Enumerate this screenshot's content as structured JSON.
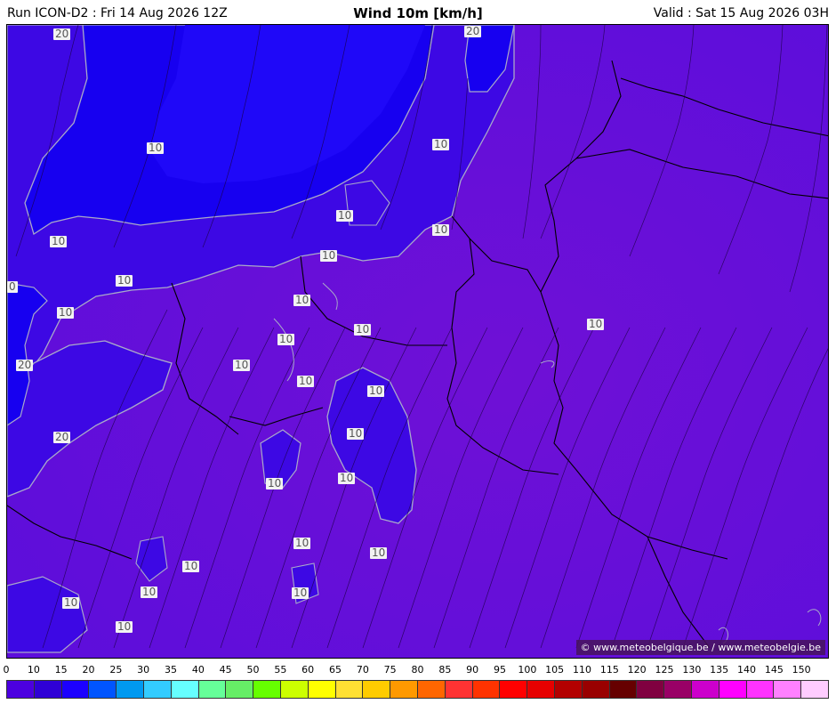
{
  "header": {
    "run": "Run ICON-D2 : Fri 14 Aug 2026 12Z",
    "title": "Wind 10m [km/h]",
    "valid": "Valid : Sat 15 Aug 2026 03H"
  },
  "map": {
    "credit": "© www.meteobelgique.be / www.meteobelgie.be",
    "contour_labels": [
      "20",
      "20",
      "10",
      "10",
      "10",
      "10",
      "10",
      "10",
      "10",
      "10",
      "0",
      "10",
      "10",
      "10",
      "10",
      "20",
      "10",
      "10",
      "10",
      "10",
      "20",
      "10",
      "10",
      "10",
      "10",
      "10",
      "10",
      "10",
      "10",
      "10"
    ],
    "colors": {
      "sea_band_20": "#1700f0",
      "band_10": "#3d08e4",
      "land_0_10": "#6a0ed7",
      "band_light_25": "#1e6cf4",
      "contour_line": "#a9a9c9",
      "border_line": "#000000"
    }
  },
  "scale": {
    "ticks": [
      "0",
      "10",
      "15",
      "20",
      "25",
      "30",
      "35",
      "40",
      "45",
      "50",
      "55",
      "60",
      "65",
      "70",
      "75",
      "80",
      "85",
      "90",
      "95",
      "100",
      "105",
      "110",
      "115",
      "120",
      "125",
      "130",
      "135",
      "140",
      "145",
      "150"
    ],
    "colors": [
      "#4c00e0",
      "#2f00d6",
      "#1c00ff",
      "#0055ff",
      "#0099f0",
      "#33ccff",
      "#66ffff",
      "#66ff99",
      "#66ee66",
      "#66ff00",
      "#ccff00",
      "#ffff00",
      "#ffe033",
      "#ffcc00",
      "#ff9900",
      "#ff6600",
      "#ff3333",
      "#ff3300",
      "#ff0000",
      "#e60000",
      "#b30000",
      "#990000",
      "#660000",
      "#800040",
      "#990066",
      "#cc00cc",
      "#ff00ff",
      "#ff33ff",
      "#ff80ff",
      "#ffccff"
    ]
  }
}
